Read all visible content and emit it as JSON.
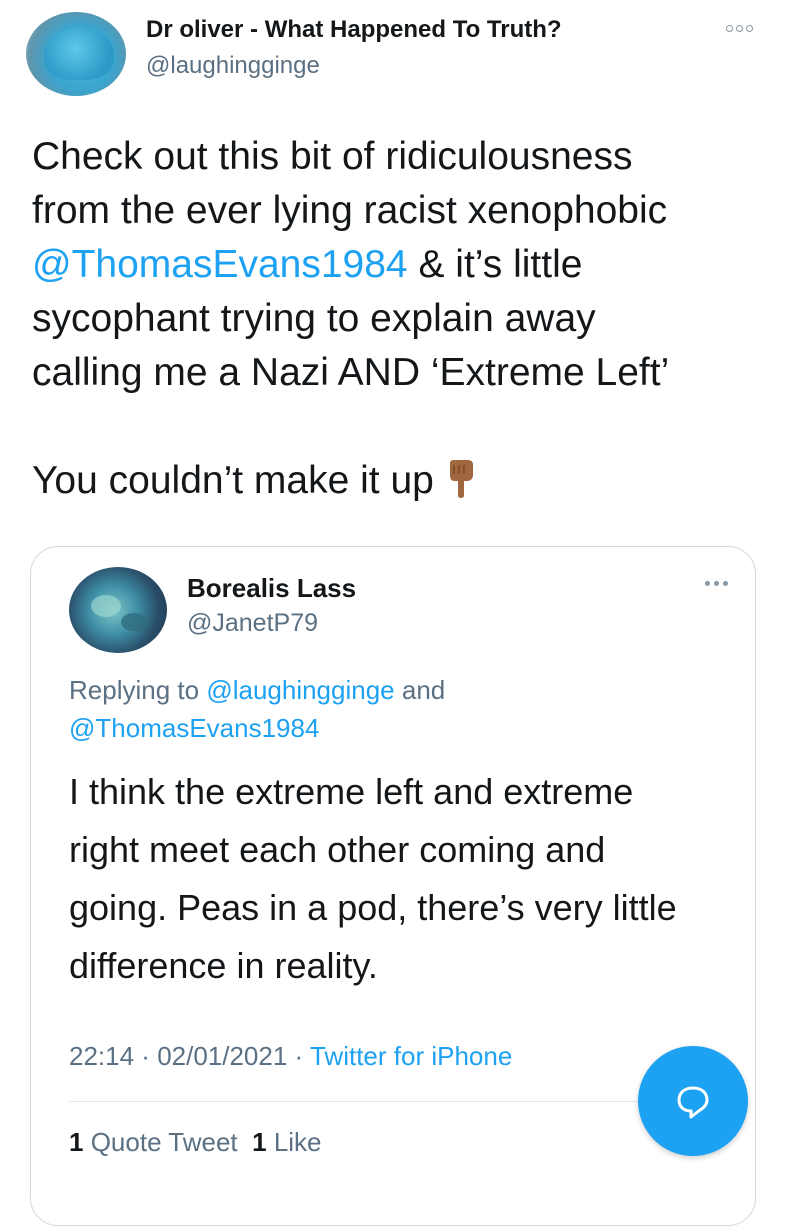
{
  "tweet": {
    "author_name": "Dr oliver - What Happened To Truth?",
    "author_handle": "@laughingginge",
    "more_icon": "more-horizontal-icon",
    "text_lines": [
      "Check out this bit of ridiculousness",
      "from the ever lying racist xenophobic"
    ],
    "mention": "@ThomasEvans1984",
    "line3_rest": " & it’s little",
    "text_lines_after": [
      "sycophant trying to explain away",
      "calling me a Nazi AND ‘Extreme Left’"
    ],
    "closing": "You couldn’t make it up",
    "emoji_icon": "pointing-down-hand-icon"
  },
  "quoted_tweet": {
    "author_name": "Borealis Lass",
    "author_handle": "@JanetP79",
    "replying_prefix": "Replying to ",
    "replying_to_1": "@laughingginge",
    "replying_and": " and",
    "replying_to_2": "@ThomasEvans1984",
    "text_lines": [
      "I think the extreme left and extreme",
      "right meet each other coming and",
      "going. Peas in a pod, there’s very little",
      "difference in reality."
    ],
    "time": "22:14",
    "separator": " · ",
    "date": "02/01/2021",
    "source": "Twitter for iPhone",
    "quote_tweet_count": "1",
    "quote_tweet_label": "Quote Tweet",
    "like_count": "1",
    "like_label": "Like"
  },
  "compose_button_icon": "reply-bubble-icon",
  "colors": {
    "link": "#1da1f2",
    "secondary_text": "#5b7083",
    "fab": "#1da1f2"
  }
}
